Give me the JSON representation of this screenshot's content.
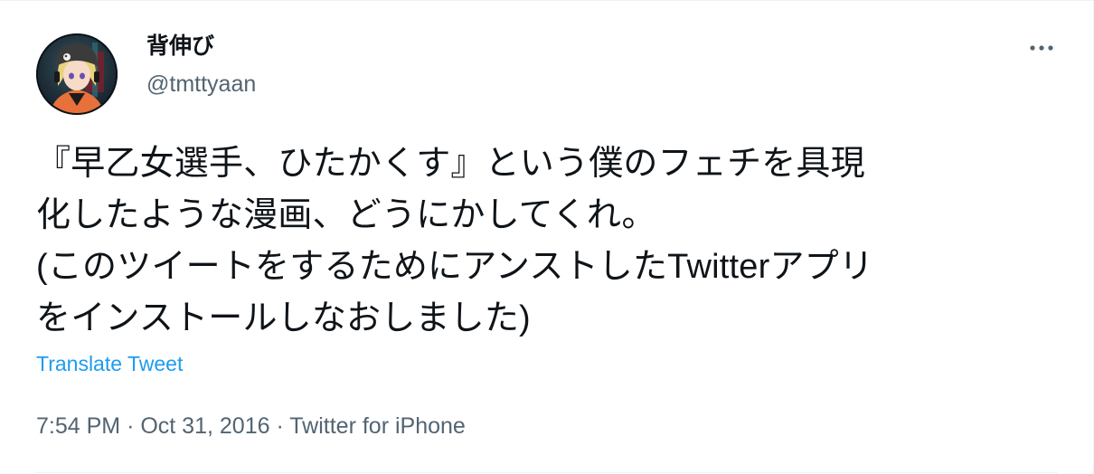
{
  "author": {
    "display_name": "背伸び",
    "handle": "@tmttyaan"
  },
  "tweet": {
    "lines": [
      "『早乙女選手、ひたかくす』という僕のフェチを具現",
      "化したような漫画、どうにかしてくれ。",
      "(このツイートをするためにアンストしたTwitterアプリ",
      "をインストールしなおしました)"
    ],
    "translate_label": "Translate Tweet"
  },
  "meta": {
    "time": "7:54 PM",
    "separator": "·",
    "date": "Oct 31, 2016",
    "source": "Twitter for iPhone"
  },
  "icons": {
    "more": "more-horizontal-icon",
    "avatar": "avatar-image"
  },
  "colors": {
    "text": "#0f1419",
    "secondary": "#536471",
    "link": "#1d9bf0"
  }
}
